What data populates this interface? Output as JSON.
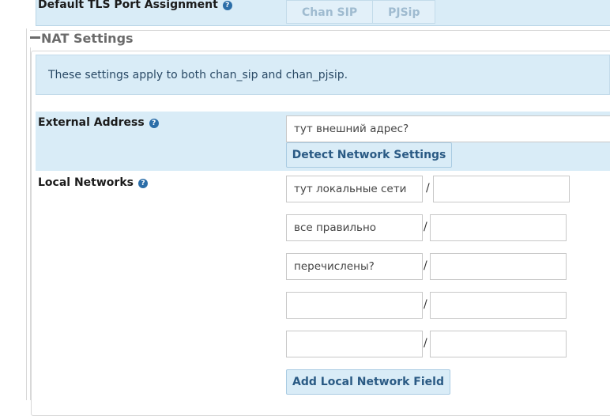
{
  "tls": {
    "label": "Default TLS Port Assignment",
    "options": [
      "Chan SIP",
      "PJSip"
    ]
  },
  "nat": {
    "section_title": "NAT Settings",
    "info": "These settings apply to both chan_sip and chan_pjsip."
  },
  "external": {
    "label": "External Address",
    "value": "тут внешний адрес?",
    "detect_button": "Detect Network Settings"
  },
  "local_networks": {
    "label": "Local Networks",
    "rows": [
      {
        "network": "тут локальные сети",
        "mask": ""
      },
      {
        "network": "все правильно",
        "mask": ""
      },
      {
        "network": "перечислены?",
        "mask": ""
      },
      {
        "network": "",
        "mask": ""
      },
      {
        "network": "",
        "mask": ""
      }
    ],
    "separator": "/",
    "add_button": "Add Local Network Field"
  },
  "icons": {
    "help": "question-circle-icon",
    "collapse": "minus-icon"
  }
}
